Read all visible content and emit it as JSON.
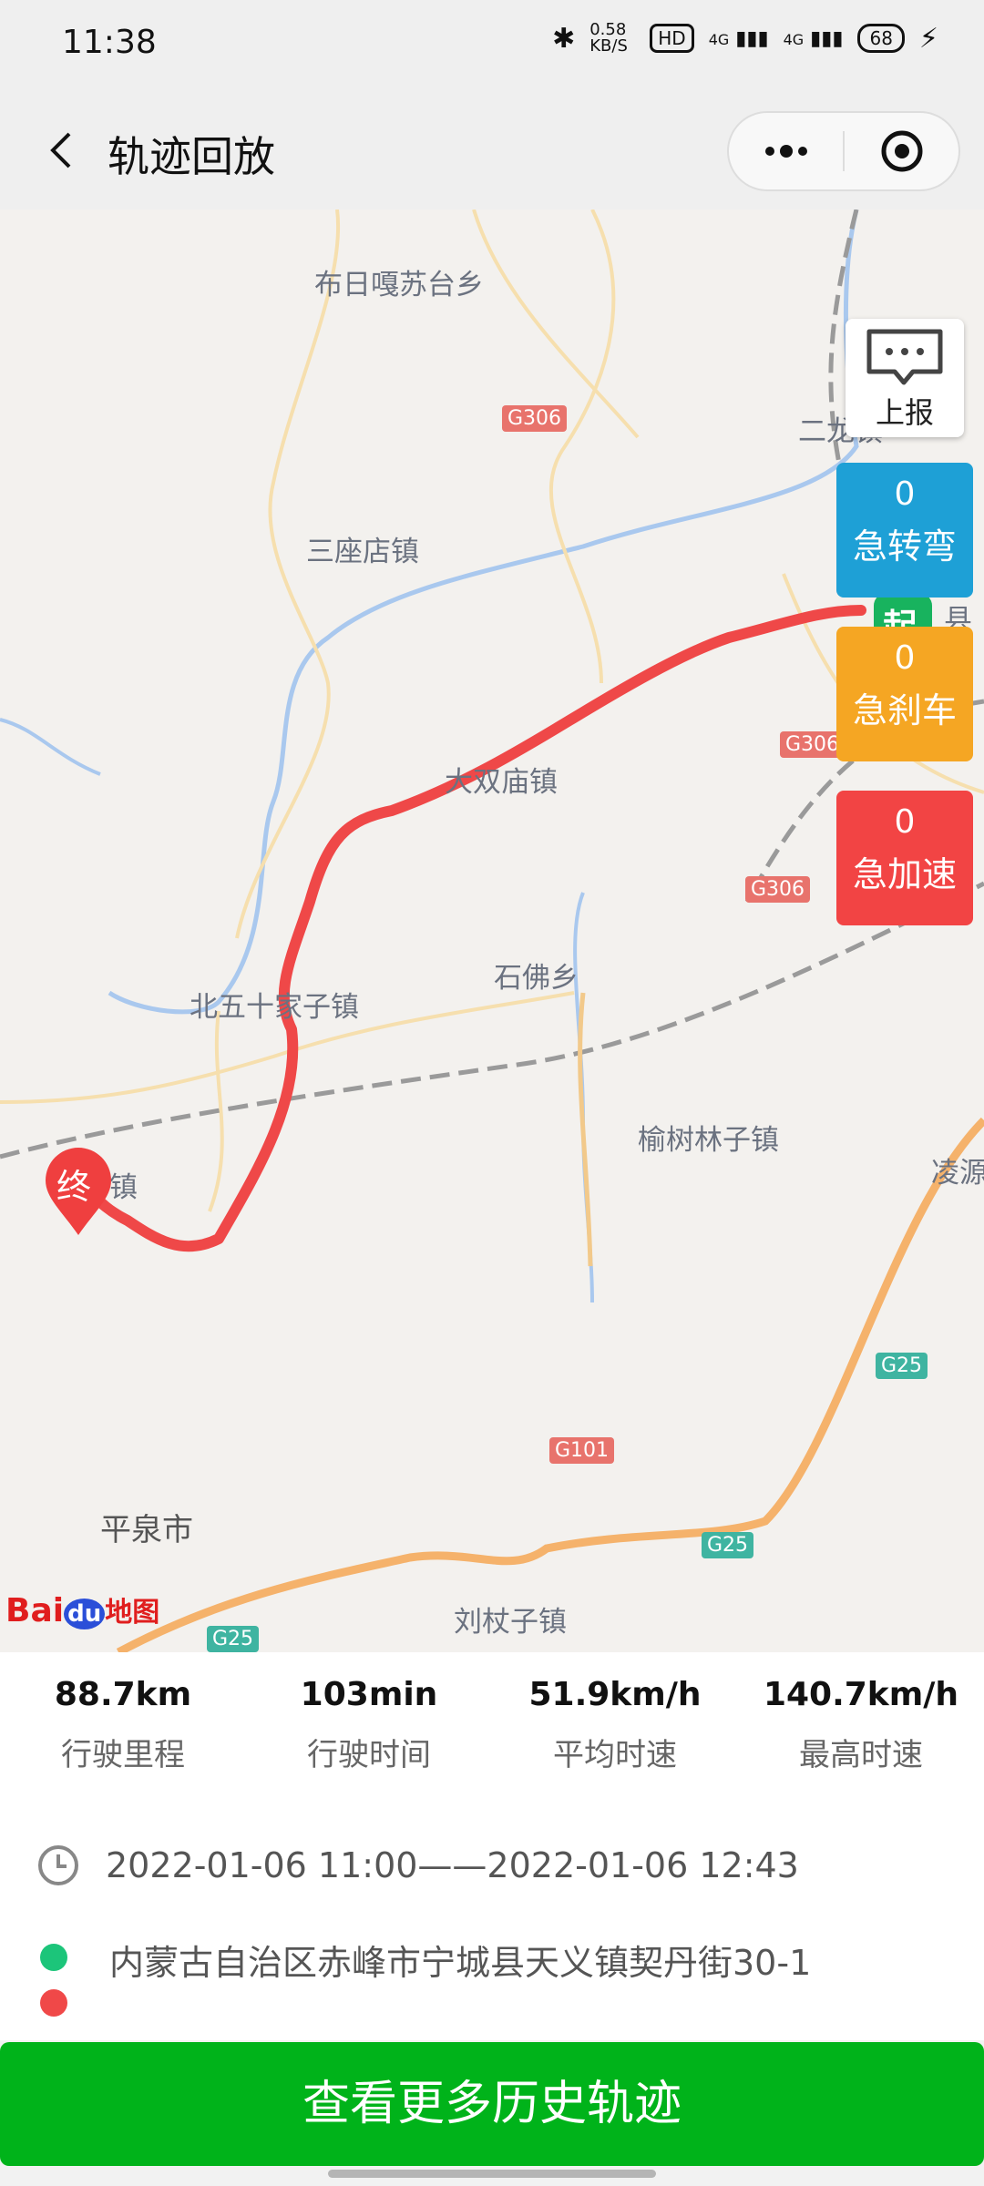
{
  "status_bar": {
    "time": "11:38",
    "net_speed": "0.58 KB/S",
    "hd": "HD",
    "signal1": "4G",
    "signal2": "4G",
    "battery": "68"
  },
  "nav": {
    "title": "轨迹回放"
  },
  "map": {
    "places": [
      "布日嘎苏台乡",
      "三座店镇",
      "大双庙镇",
      "石佛乡",
      "北五十家子镇",
      "榆树林子镇",
      "平泉市",
      "刘杖子镇",
      "镇",
      "凌源",
      "二龙镇",
      "县"
    ],
    "roads": [
      "G306",
      "G306",
      "G306",
      "G101",
      "G25",
      "G25",
      "G25"
    ],
    "end_marker": "终",
    "start_marker": "起",
    "logo": {
      "bai": "Bai",
      "du": "du",
      "map": "地图"
    }
  },
  "side_panel": {
    "report_label": "上报",
    "events": [
      {
        "count": "0",
        "label": "急转弯",
        "color": "#1ea0d6"
      },
      {
        "count": "0",
        "label": "急刹车",
        "color": "#f5a623"
      },
      {
        "count": "0",
        "label": "急加速",
        "color": "#f24444"
      }
    ]
  },
  "stats": [
    {
      "value": "88.7km",
      "label": "行驶里程"
    },
    {
      "value": "103min",
      "label": "行驶时间"
    },
    {
      "value": "51.9km/h",
      "label": "平均时速"
    },
    {
      "value": "140.7km/h",
      "label": "最高时速"
    }
  ],
  "trip": {
    "time_range": "2022-01-06 11:00——2022-01-06 12:43",
    "address": "内蒙古自治区赤峰市宁城县天义镇契丹街30-1",
    "start_dot_color": "#1cc57a",
    "end_dot_color": "#f04848"
  },
  "action": {
    "more_history": "查看更多历史轨迹"
  }
}
